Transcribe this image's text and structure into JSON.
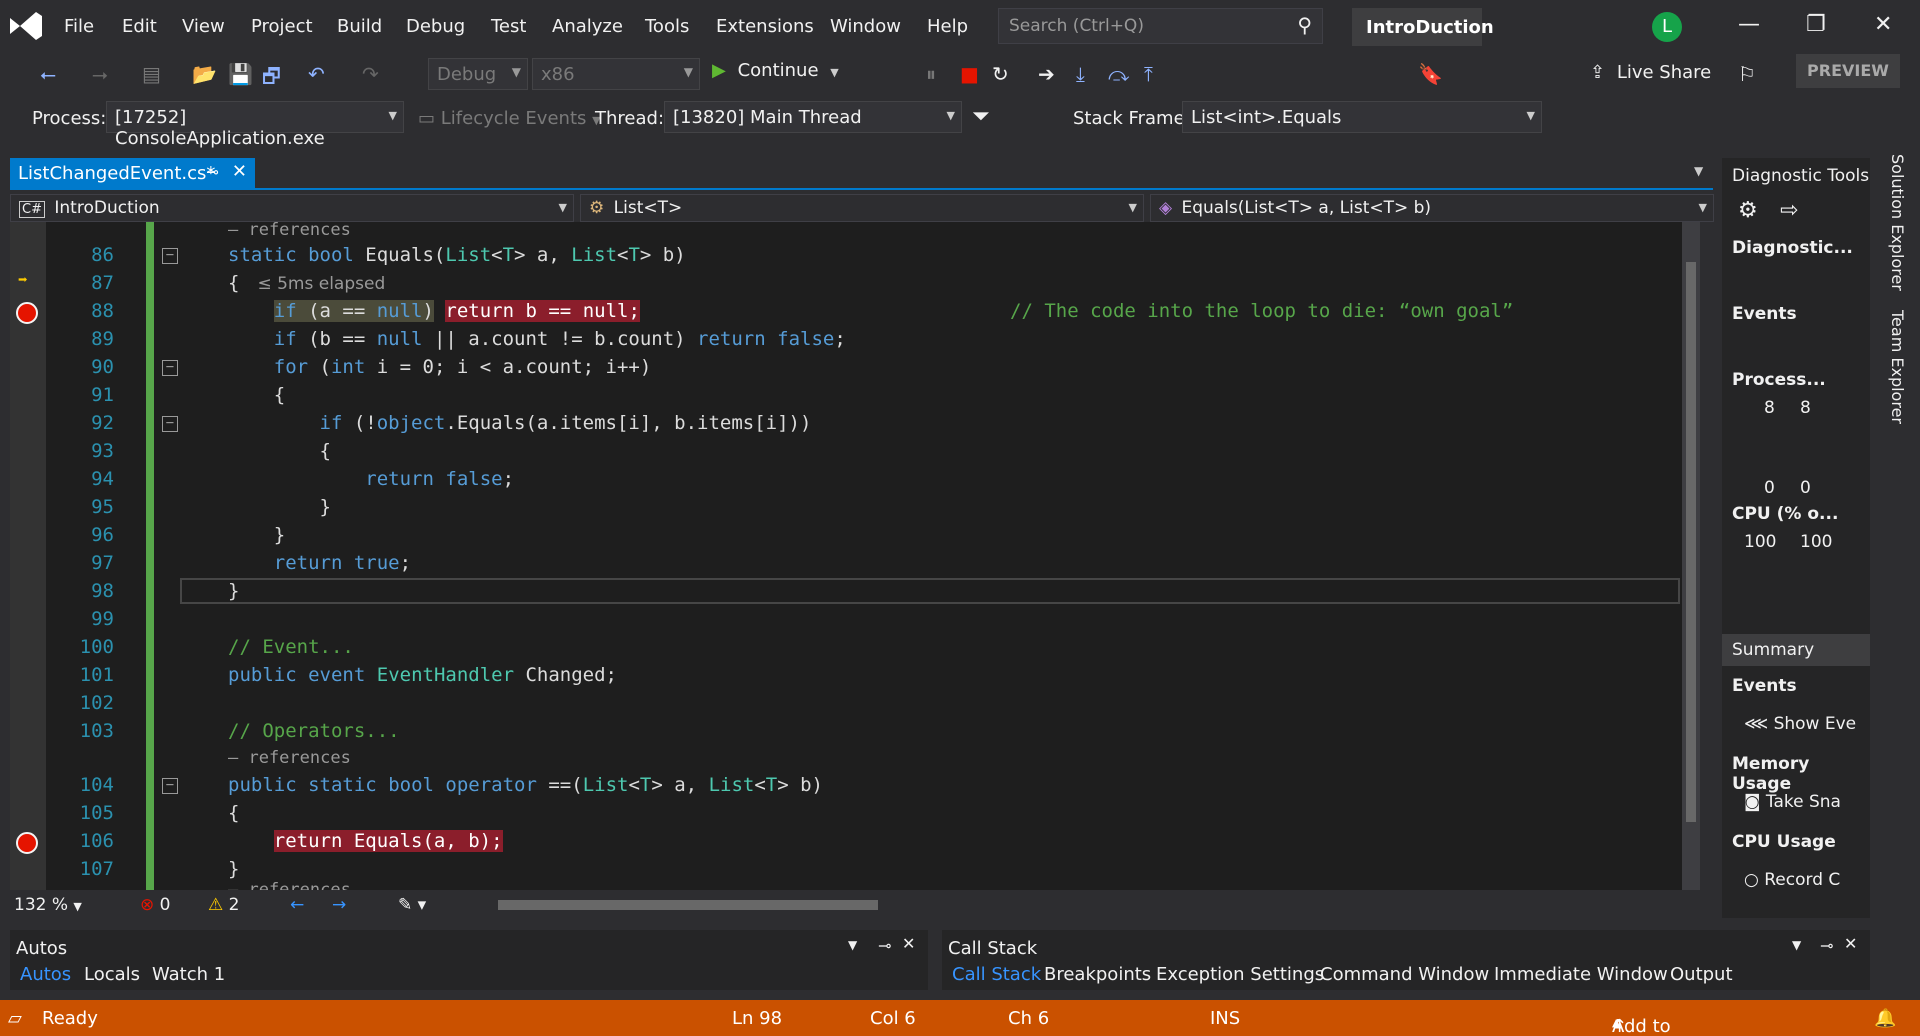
{
  "menu": [
    "File",
    "Edit",
    "View",
    "Project",
    "Build",
    "Debug",
    "Test",
    "Analyze",
    "Tools",
    "Extensions",
    "Window",
    "Help"
  ],
  "search": {
    "placeholder": "Search (Ctrl+Q)"
  },
  "solution_name": "IntroDuction",
  "user_initial": "L",
  "toolbar": {
    "config": "Debug",
    "platform": "x86",
    "continue_label": "Continue",
    "live_share": "Live Share",
    "preview": "PREVIEW"
  },
  "debug_location": {
    "process_label": "Process:",
    "process_value": "[17252] ConsoleApplication.exe",
    "lifecycle": "Lifecycle Events",
    "thread_label": "Thread:",
    "thread_value": "[13820] Main Thread",
    "stack_label": "Stack Frame:",
    "stack_value": "List<int>.Equals"
  },
  "document_tab": "ListChangedEvent.cs*",
  "nav": {
    "project": "IntroDuction",
    "type": "List<T>",
    "member": "Equals(List<T> a, List<T> b)"
  },
  "editor": {
    "references": "– references",
    "elapsed": "≤ 5ms elapsed",
    "line_numbers": [
      "86",
      "87",
      "88",
      "89",
      "90",
      "91",
      "92",
      "93",
      "94",
      "95",
      "96",
      "97",
      "98",
      "99",
      "100",
      "101",
      "102",
      "103",
      "104",
      "105",
      "106",
      "107"
    ],
    "comment_88": "// The code into the loop to die: “own goal”"
  },
  "editor_status": {
    "zoom": "132 %",
    "errors": "0",
    "warnings": "2"
  },
  "diagnostic": {
    "title": "Diagnostic Tools",
    "session": "Diagnostic...",
    "events": "Events",
    "process": "Process...",
    "proc_max": "8",
    "proc_max2": "8",
    "proc_min": "0",
    "proc_min2": "0",
    "cpu": "CPU (% o...",
    "cpu_max": "100",
    "cpu_max2": "100",
    "summary": "Summary",
    "events_h": "Events",
    "show_events": "Show Eve",
    "memory": "Memory Usage",
    "take_snapshot": "Take Sna",
    "cpu_usage": "CPU Usage",
    "record": "Record C"
  },
  "side_tabs": [
    "Solution Explorer",
    "Team Explorer"
  ],
  "left_panel": {
    "title": "Autos",
    "tabs": [
      "Autos",
      "Locals",
      "Watch 1"
    ]
  },
  "right_panel": {
    "title": "Call Stack",
    "tabs": [
      "Call Stack",
      "Breakpoints",
      "Exception Settings",
      "Command Window",
      "Immediate Window",
      "Output"
    ]
  },
  "status": {
    "ready": "Ready",
    "ln": "Ln 98",
    "col": "Col 6",
    "ch": "Ch 6",
    "ins": "INS",
    "source_control": "Add to Source Control"
  }
}
